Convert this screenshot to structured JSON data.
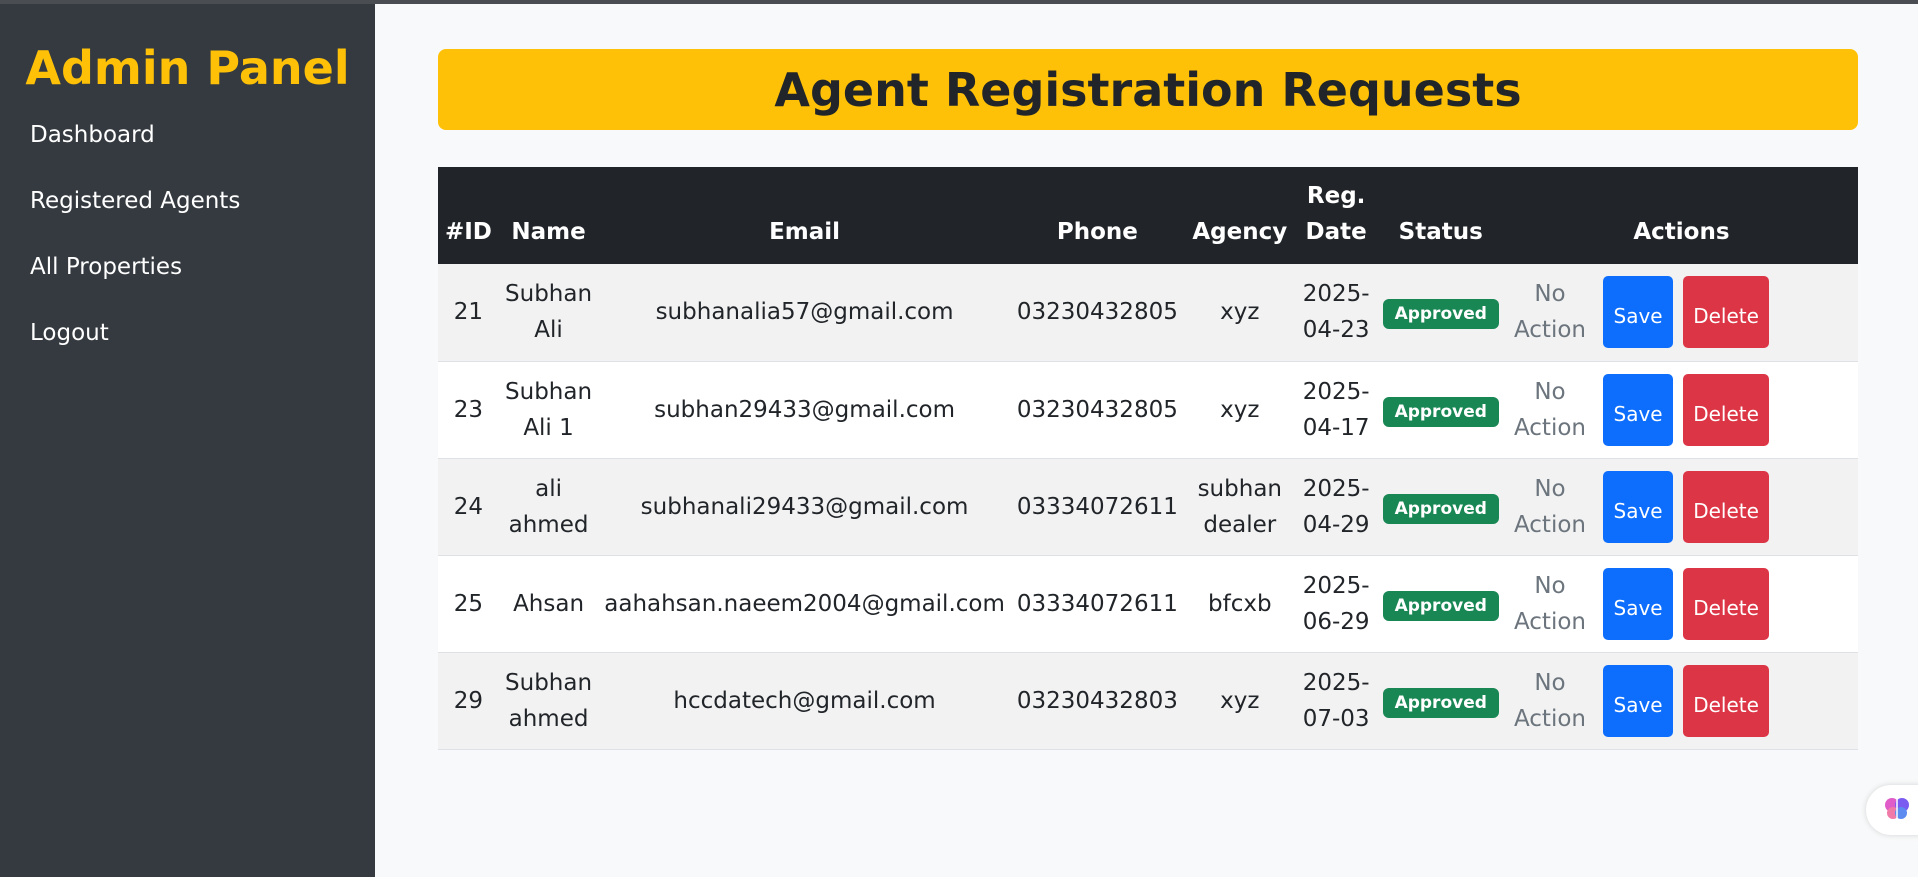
{
  "sidebar": {
    "brand": "Admin Panel",
    "items": [
      {
        "label": "Dashboard"
      },
      {
        "label": "Registered Agents"
      },
      {
        "label": "All Properties"
      },
      {
        "label": "Logout"
      }
    ]
  },
  "main": {
    "title": "Agent Registration Requests",
    "table": {
      "headers": {
        "id": "#ID",
        "name": "Name",
        "email": "Email",
        "phone": "Phone",
        "agency": "Agency",
        "reg_date_1": "Reg.",
        "reg_date_2": "Date",
        "status": "Status",
        "actions": "Actions"
      },
      "rows": [
        {
          "id": "21",
          "name": "Subhan Ali",
          "email": "subhanalia57@gmail.com",
          "phone": "03230432805",
          "agency": "xyz",
          "date_1": "2025-",
          "date_2": "04-23",
          "status": "Approved",
          "action_1": "No",
          "action_2": "Action",
          "save": "Save",
          "delete": "Delete"
        },
        {
          "id": "23",
          "name": "Subhan Ali 1",
          "email": "subhan29433@gmail.com",
          "phone": "03230432805",
          "agency": "xyz",
          "date_1": "2025-",
          "date_2": "04-17",
          "status": "Approved",
          "action_1": "No",
          "action_2": "Action",
          "save": "Save",
          "delete": "Delete"
        },
        {
          "id": "24",
          "name": "ali ahmed",
          "email": "subhanali29433@gmail.com",
          "phone": "03334072611",
          "agency": "subhan dealer",
          "date_1": "2025-",
          "date_2": "04-29",
          "status": "Approved",
          "action_1": "No",
          "action_2": "Action",
          "save": "Save",
          "delete": "Delete"
        },
        {
          "id": "25",
          "name": "Ahsan",
          "email": "aahahsan.naeem2004@gmail.com",
          "phone": "03334072611",
          "agency": "bfcxb",
          "date_1": "2025-",
          "date_2": "06-29",
          "status": "Approved",
          "action_1": "No",
          "action_2": "Action",
          "save": "Save",
          "delete": "Delete"
        },
        {
          "id": "29",
          "name": "Subhan ahmed",
          "email": "hccdatech@gmail.com",
          "phone": "03230432803",
          "agency": "xyz",
          "date_1": "2025-",
          "date_2": "07-03",
          "status": "Approved",
          "action_1": "No",
          "action_2": "Action",
          "save": "Save",
          "delete": "Delete"
        }
      ]
    }
  },
  "colors": {
    "sidebar_bg": "#343a40",
    "brand": "#ffc107",
    "header_bg": "#ffc107",
    "table_head_bg": "#212529",
    "approved": "#198754",
    "save": "#0d6efd",
    "delete": "#dc3545"
  },
  "icons": {
    "floating": "brain-icon"
  }
}
